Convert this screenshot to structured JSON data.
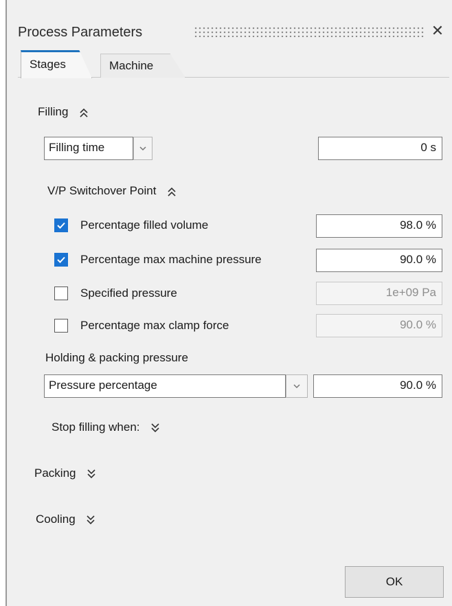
{
  "window": {
    "title": "Process Parameters",
    "close_icon": "close-icon"
  },
  "tabs": [
    {
      "label": "Stages",
      "active": true
    },
    {
      "label": "Machine",
      "active": false
    }
  ],
  "filling": {
    "label": "Filling",
    "control_mode": {
      "selected": "Filling time"
    },
    "time_value": "0 s",
    "vp_switchover": {
      "label": "V/P Switchover Point",
      "options": [
        {
          "label": "Percentage filled volume",
          "checked": true,
          "value": "98.0 %",
          "enabled": true
        },
        {
          "label": "Percentage max machine pressure",
          "checked": true,
          "value": "90.0 %",
          "enabled": true
        },
        {
          "label": "Specified pressure",
          "checked": false,
          "value": "1e+09 Pa",
          "enabled": false
        },
        {
          "label": "Percentage max clamp force",
          "checked": false,
          "value": "90.0 %",
          "enabled": false
        }
      ]
    },
    "holding": {
      "label": "Holding & packing pressure",
      "mode": {
        "selected": "Pressure percentage"
      },
      "value": "90.0 %"
    },
    "stop_filling_label": "Stop filling when:"
  },
  "packing": {
    "label": "Packing"
  },
  "cooling": {
    "label": "Cooling"
  },
  "ok_label": "OK",
  "colors": {
    "accent": "#1e73be",
    "checkbox": "#1a73d2"
  }
}
